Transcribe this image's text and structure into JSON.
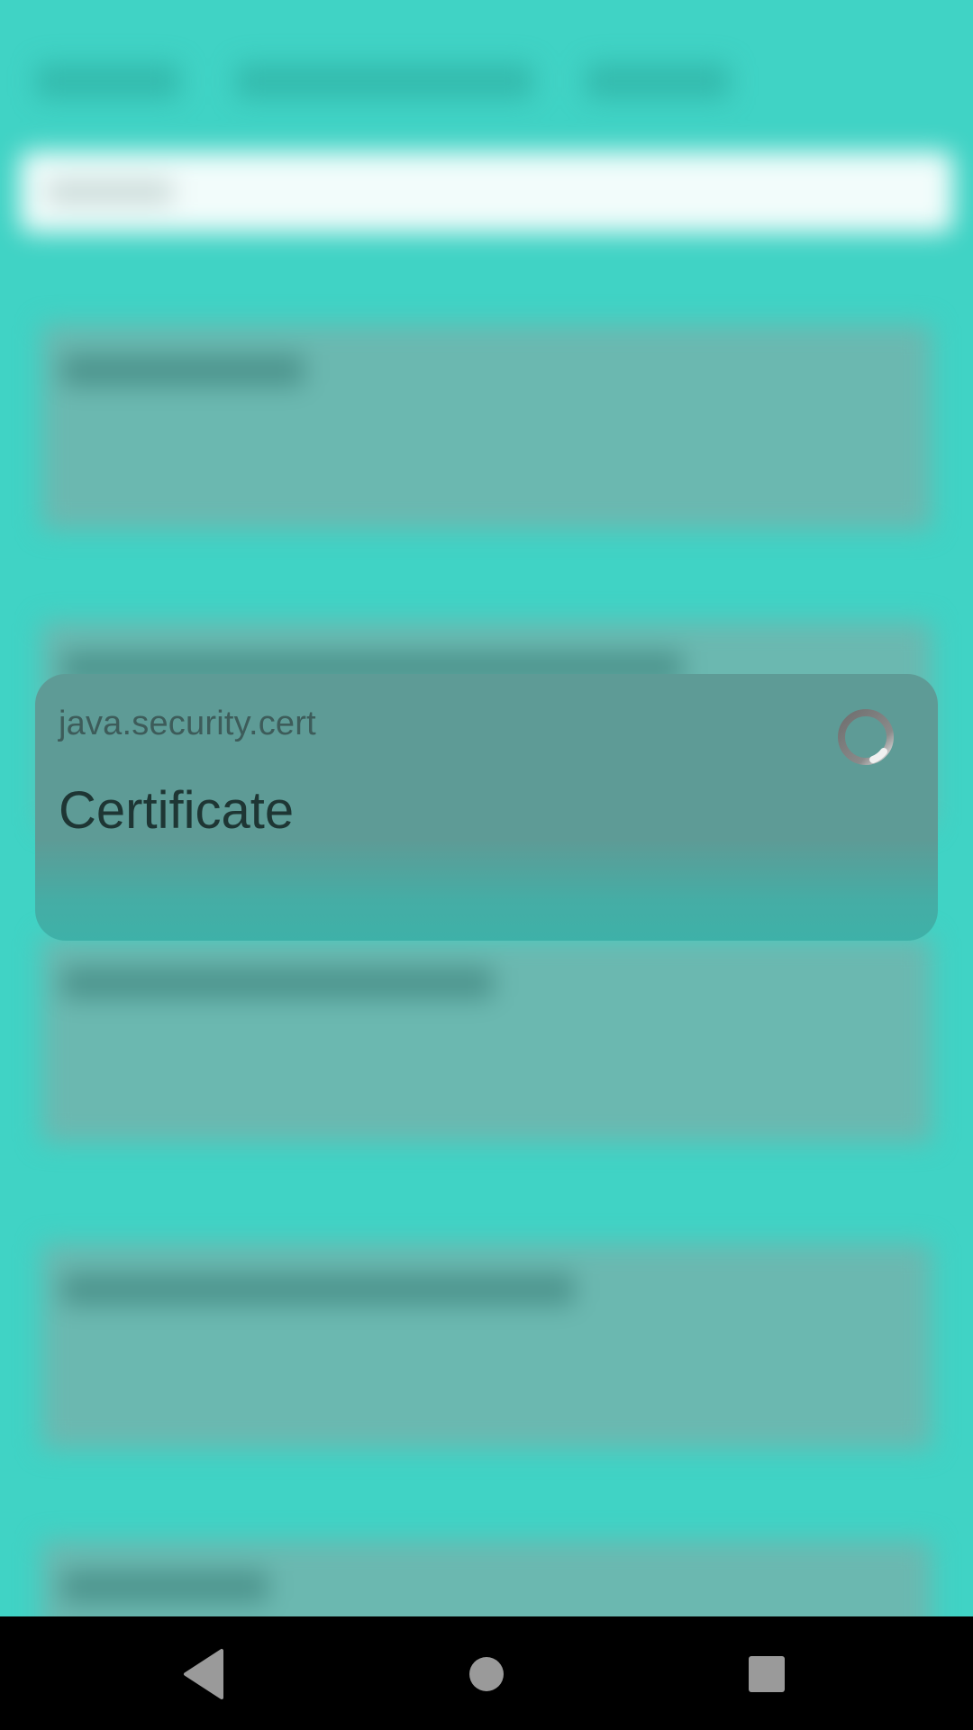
{
  "focused_card": {
    "package": "java.security.cert",
    "class_name": "Certificate",
    "loading_icon": "spinner-icon"
  },
  "navigation_bar": {
    "back_icon": "back-triangle-icon",
    "home_icon": "home-circle-icon",
    "recents_icon": "recents-square-icon"
  },
  "colors": {
    "background": "#40d3c5",
    "card_bg": "#6bb8b0",
    "focused_card": "#5e9b96",
    "search_bar": "#f2fcfb",
    "nav_bar": "#000000",
    "nav_icon": "#9a9a9a"
  }
}
